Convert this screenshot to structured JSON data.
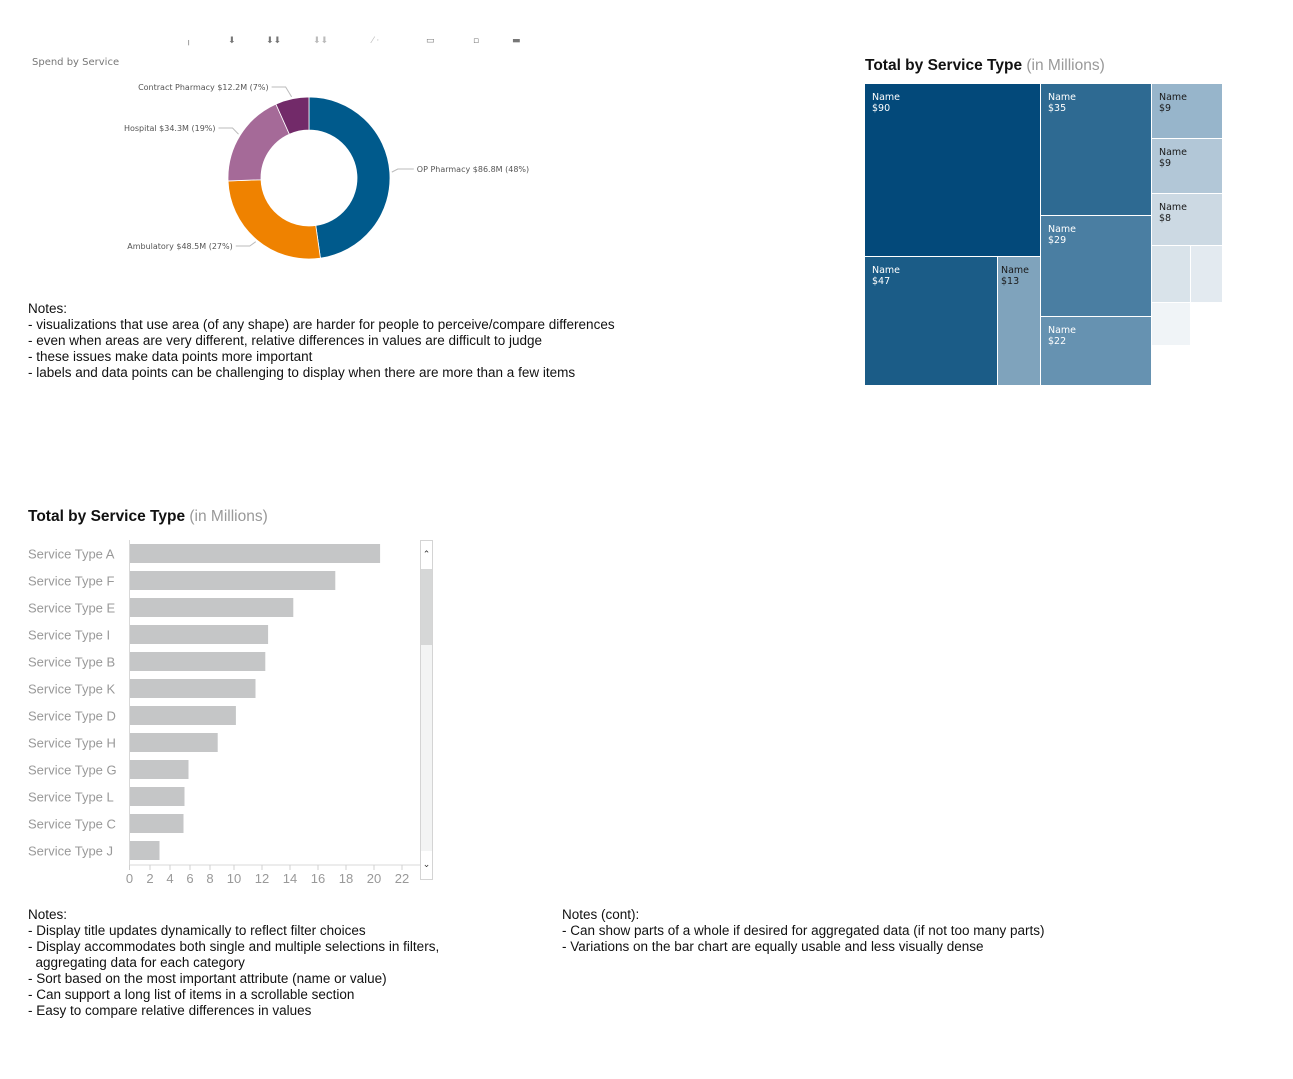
{
  "toolbar": {
    "icons": [
      "focus-icon",
      "drill-down-icon",
      "expand-all-down-icon",
      "drill-up-icon",
      "pin-icon",
      "focus-mode-icon",
      "filter-icon",
      "more-options-icon"
    ]
  },
  "donut": {
    "title": "Spend by Service",
    "colors": {
      "op_pharmacy": "#005A8C",
      "ambulatory": "#EF8200",
      "hospital": "#A56A98",
      "contract_pharmacy": "#722A69"
    }
  },
  "treemap": {
    "title": "Total by Service Type",
    "subtitle": "(in Millions)"
  },
  "bar": {
    "title": "Total by Service Type",
    "subtitle": "(in Millions)",
    "bar_color": "#C5C6C7",
    "scroll_up": "⌃",
    "scroll_down": "⌄",
    "scroll_position": 0.1
  },
  "notes_top": {
    "heading": "Notes:",
    "lines": [
      "- visualizations that use area (of any shape) are harder for people to perceive/compare differences",
      "- even when areas are very different, relative differences in values are difficult to judge",
      "- these issues make data points more important",
      "- labels and data points can be challenging to display when there are more than a few items"
    ]
  },
  "notes_bottom_left": {
    "heading": "Notes:",
    "lines": [
      "- Display title updates dynamically to reflect filter choices",
      "- Display accommodates both single and multiple selections in filters,",
      "  aggregating data for each category",
      "- Sort based on the most important attribute (name or value)",
      "- Can support a long list of items in a scrollable section",
      "- Easy to compare relative differences in values"
    ]
  },
  "notes_bottom_right": {
    "heading": "Notes (cont):",
    "lines": [
      "- Can show parts of a whole if desired for aggregated data (if not too many parts)",
      "- Variations on the bar chart are equally usable and less visually dense"
    ]
  },
  "chart_data": [
    {
      "type": "pie",
      "title": "Spend by Service",
      "variant": "donut",
      "slices": [
        {
          "name": "OP Pharmacy",
          "value": 86.8,
          "percent": 48,
          "label": "OP Pharmacy $86.8M (48%)",
          "color": "#005A8C"
        },
        {
          "name": "Ambulatory",
          "value": 48.5,
          "percent": 27,
          "label": "Ambulatory $48.5M (27%)",
          "color": "#EF8200"
        },
        {
          "name": "Hospital",
          "value": 34.3,
          "percent": 19,
          "label": "Hospital $34.3M (19%)",
          "color": "#A56A98"
        },
        {
          "name": "Contract Pharmacy",
          "value": 12.2,
          "percent": 7,
          "label": "Contract Pharmacy $12.2M (7%)",
          "color": "#722A69"
        }
      ]
    },
    {
      "type": "heatmap",
      "variant": "treemap",
      "title": "Total by Service Type",
      "subtitle": "(in Millions)",
      "cells": [
        {
          "name": "Name",
          "value": "$90",
          "color": "#03497A",
          "text_color": "#ffffff"
        },
        {
          "name": "Name",
          "value": "$47",
          "color": "#1B5C87",
          "text_color": "#ffffff"
        },
        {
          "name": "Name",
          "value": "$13",
          "color": "#7FA3BC",
          "text_color": "#1a1a1a"
        },
        {
          "name": "Name",
          "value": "$35",
          "color": "#2E6A92",
          "text_color": "#ffffff"
        },
        {
          "name": "Name",
          "value": "$29",
          "color": "#4A7EA2",
          "text_color": "#ffffff"
        },
        {
          "name": "Name",
          "value": "$22",
          "color": "#6692B1",
          "text_color": "#ffffff"
        },
        {
          "name": "Name",
          "value": "$9",
          "color": "#97B5CB",
          "text_color": "#1a1a1a"
        },
        {
          "name": "Name",
          "value": "$9",
          "color": "#B2C7D7",
          "text_color": "#1a1a1a"
        },
        {
          "name": "Name",
          "value": "$8",
          "color": "#CCD9E3",
          "text_color": "#1a1a1a"
        },
        {
          "name": "",
          "value": "",
          "color": "#D9E3EA",
          "text_color": "#1a1a1a"
        },
        {
          "name": "",
          "value": "",
          "color": "#E3EAF0",
          "text_color": "#1a1a1a"
        },
        {
          "name": "",
          "value": "",
          "color": "#F0F4F7",
          "text_color": "#1a1a1a"
        }
      ]
    },
    {
      "type": "bar",
      "orientation": "horizontal",
      "title": "Total by Service Type",
      "subtitle": "(in Millions)",
      "categories": [
        "Service Type A",
        "Service Type F",
        "Service Type E",
        "Service Type I",
        "Service Type B",
        "Service Type K",
        "Service Type D",
        "Service Type H",
        "Service Type G",
        "Service Type L",
        "Service Type C",
        "Service Type J"
      ],
      "values": [
        20.4,
        17.2,
        14.2,
        12.4,
        12.2,
        11.5,
        10.1,
        8.6,
        5.8,
        5.4,
        5.3,
        2.9
      ],
      "xticks": [
        0,
        2,
        4,
        6,
        8,
        10,
        12,
        14,
        16,
        18,
        20,
        22
      ],
      "xlim": [
        0,
        23
      ],
      "xlabel": "",
      "ylabel": "",
      "grid": false,
      "legend": "none"
    }
  ]
}
